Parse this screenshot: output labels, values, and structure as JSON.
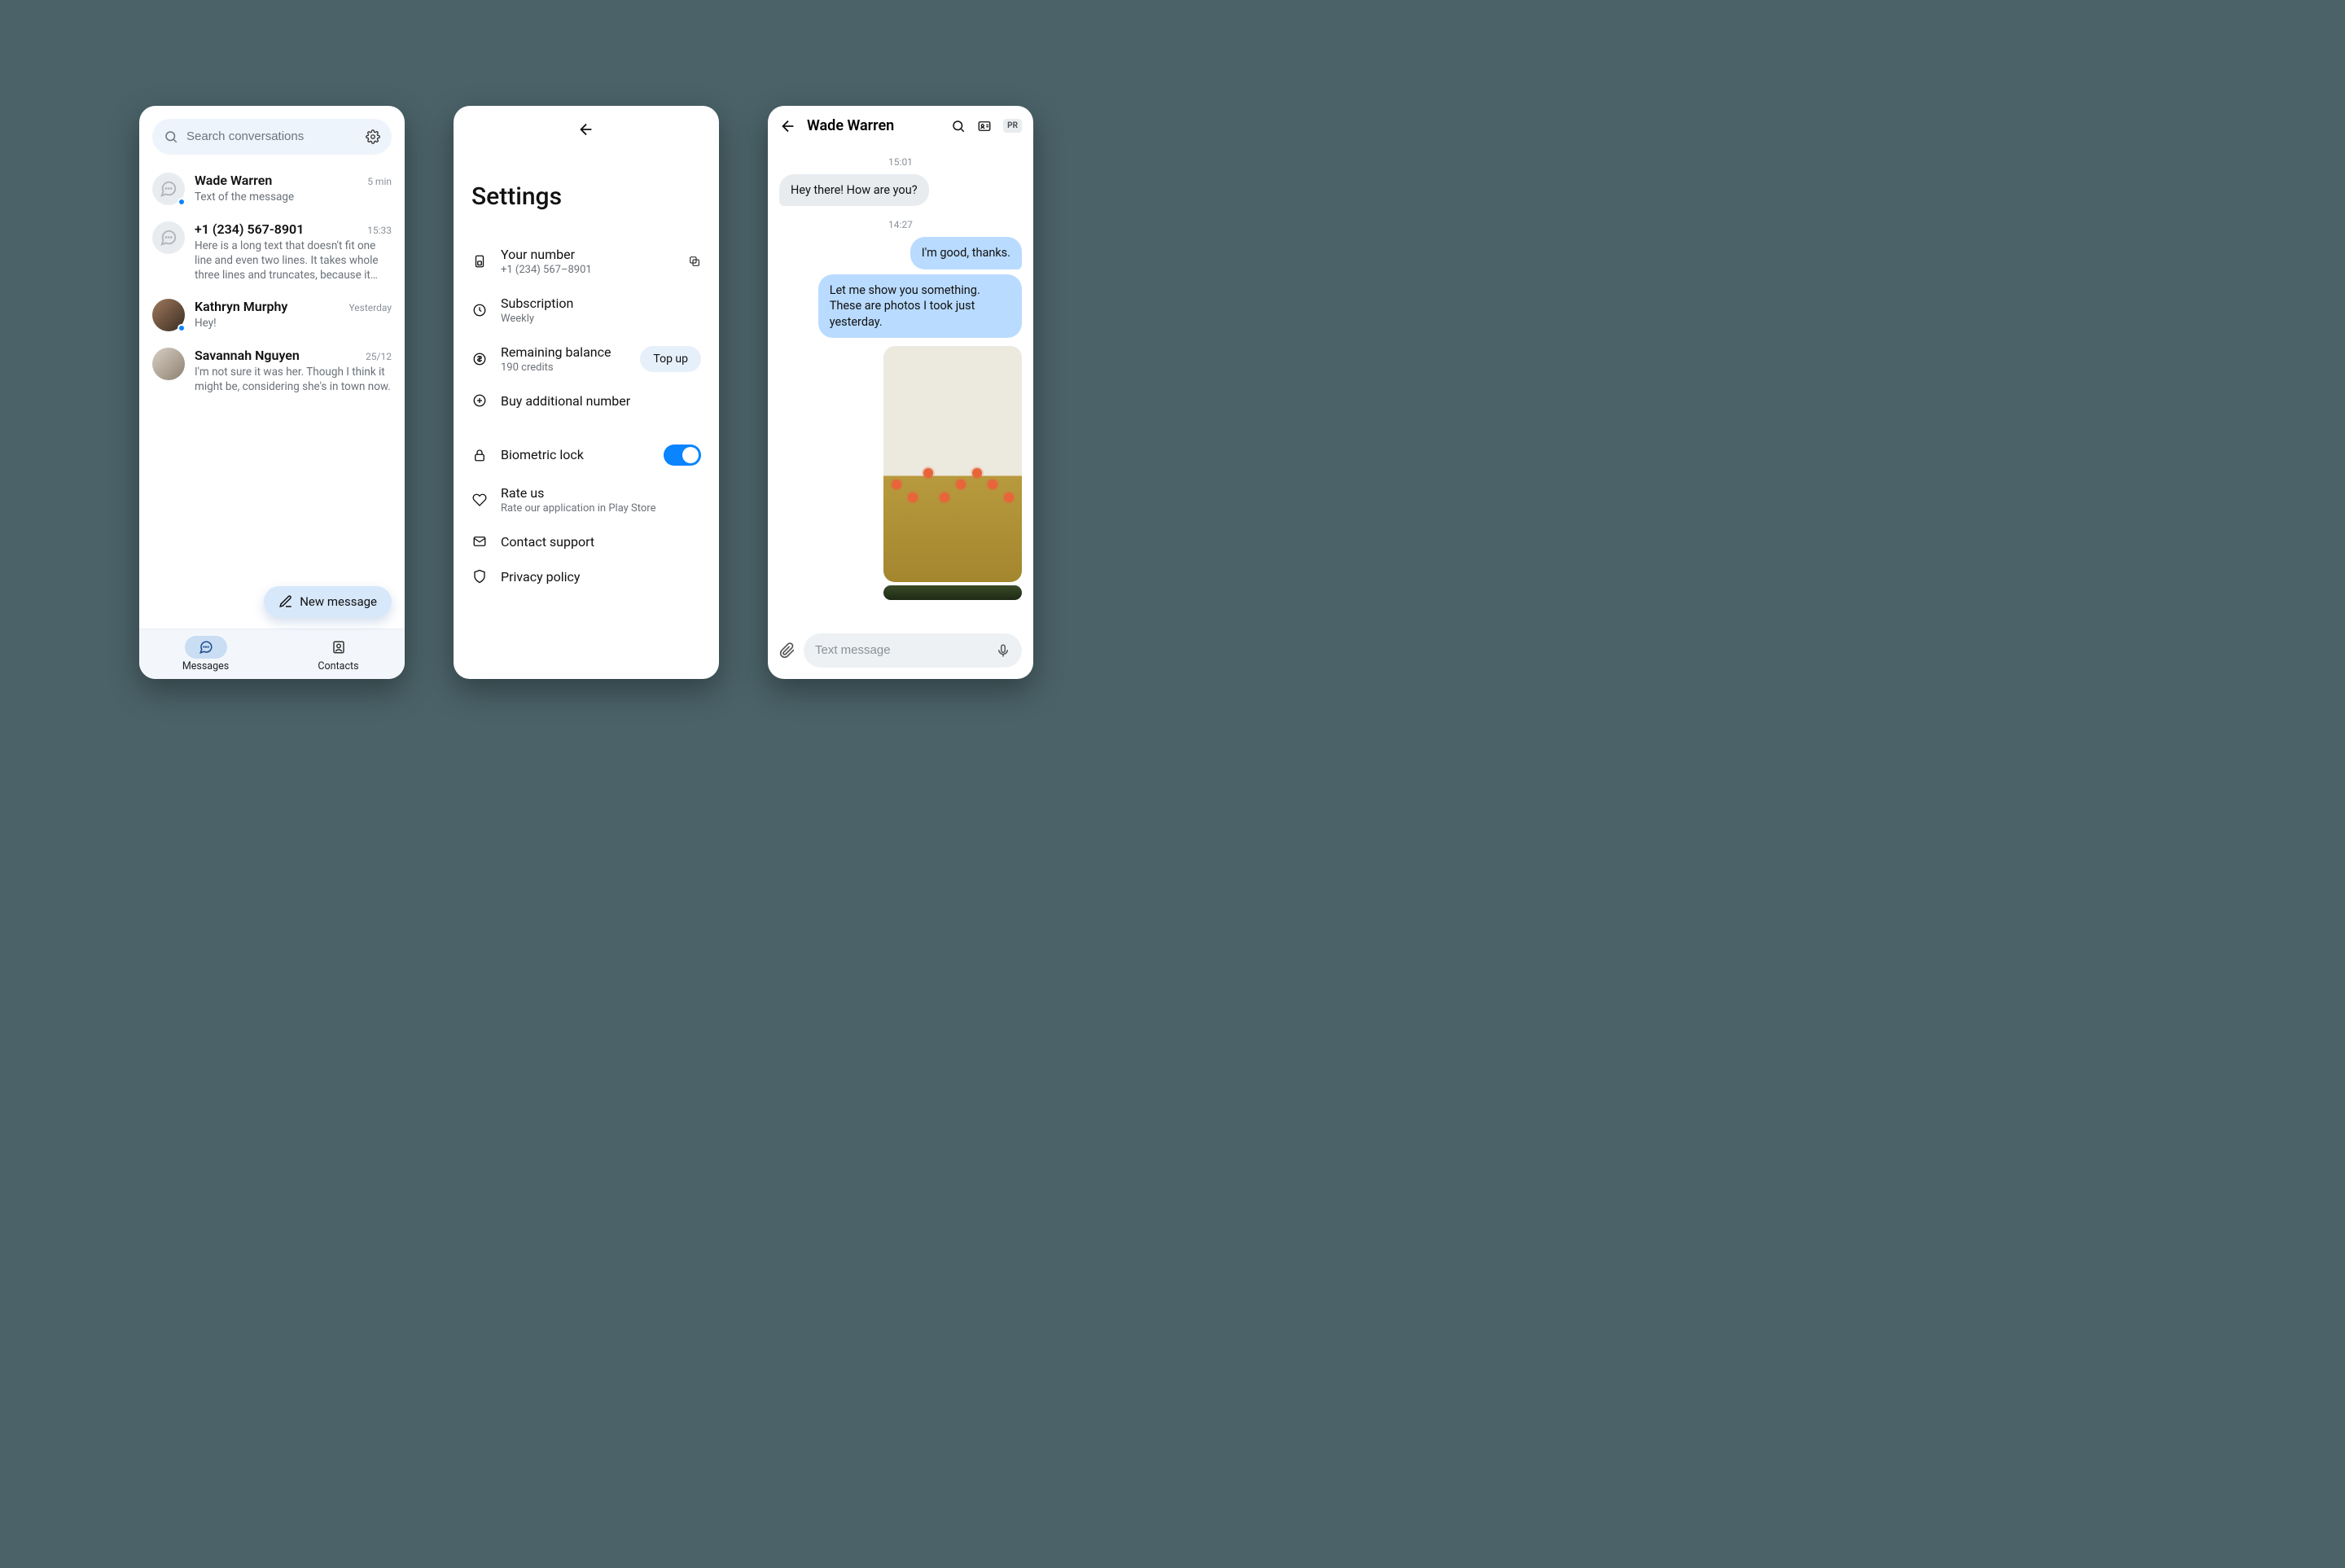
{
  "screen1": {
    "search_placeholder": "Search conversations",
    "conversations": [
      {
        "name": "Wade Warren",
        "time": "5 min",
        "preview": "Text of the message",
        "unread": true,
        "avatar": "placeholder"
      },
      {
        "name": "+1 (234) 567-8901",
        "time": "15:33",
        "preview": "Here is a long text that doesn't fit one line and even two lines. It takes whole three lines and truncates, because it ca…",
        "unread": false,
        "avatar": "placeholder"
      },
      {
        "name": "Kathryn Murphy",
        "time": "Yesterday",
        "preview": "Hey!",
        "unread": true,
        "avatar": "photo1"
      },
      {
        "name": "Savannah Nguyen",
        "time": "25/12",
        "preview": "I'm not sure it was her. Though I think it might be, considering she's in town now.",
        "unread": false,
        "avatar": "photo2"
      }
    ],
    "fab_label": "New message",
    "nav": {
      "messages": "Messages",
      "contacts": "Contacts"
    }
  },
  "screen2": {
    "title": "Settings",
    "your_number": {
      "label": "Your number",
      "value": "+1 (234) 567–8901"
    },
    "subscription": {
      "label": "Subscription",
      "value": "Weekly"
    },
    "balance": {
      "label": "Remaining balance",
      "value": "190 credits",
      "action": "Top up"
    },
    "buy_number": "Buy additional number",
    "biometric": "Biometric lock",
    "rate": {
      "label": "Rate us",
      "sub": "Rate our application in Play Store"
    },
    "support": "Contact support",
    "privacy": "Privacy policy"
  },
  "screen3": {
    "title": "Wade Warren",
    "badge": "PR",
    "ts1": "15:01",
    "msg_in1": "Hey there! How are you?",
    "ts2": "14:27",
    "msg_out1": "I'm good, thanks.",
    "msg_out2": "Let me show you something. These are photos I took just yesterday.",
    "composer_placeholder": "Text message"
  }
}
